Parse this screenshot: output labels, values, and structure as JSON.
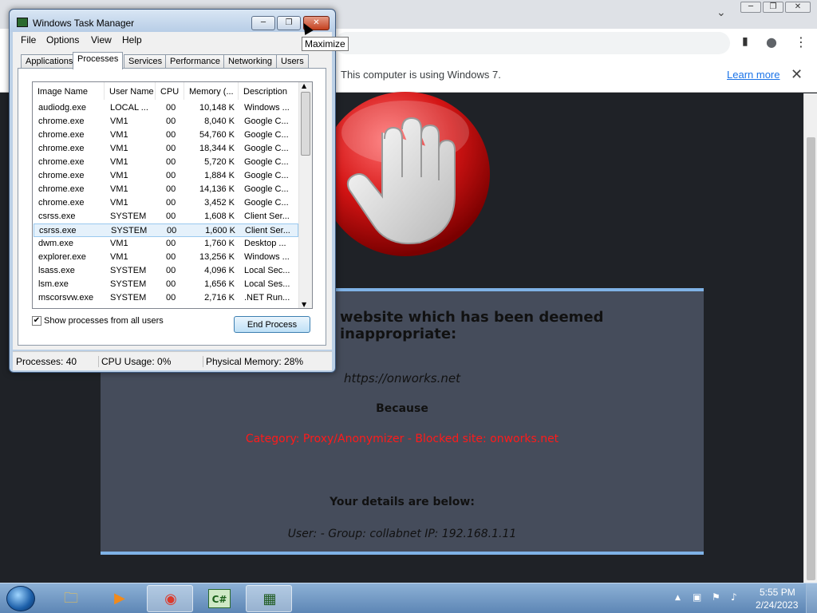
{
  "browser": {
    "window_controls": {
      "minimize": "─",
      "restore": "❐",
      "close": "✕"
    },
    "omnibox_icons": {
      "sidepanel": "▮",
      "profile": "●",
      "menu": "⋮"
    },
    "infobar": {
      "message": "This computer is using Windows 7.",
      "learn_more": "Learn more",
      "close": "✕"
    },
    "page": {
      "headline": "website which has been deemed inappropriate:",
      "blocked_url": "https://onworks.net",
      "because_label": "Because",
      "reason": "Category: Proxy/Anonymizer - Blocked site: onworks.net",
      "details_title": "Your details are below:",
      "details": "User: -    Group: collabnet    IP: 192.168.1.11"
    }
  },
  "task_manager": {
    "title": "Windows Task Manager",
    "buttons": {
      "minimize": "─",
      "maximize": "❐",
      "close": "✕"
    },
    "menu": [
      "File",
      "Options",
      "View",
      "Help"
    ],
    "tabs": [
      "Applications",
      "Processes",
      "Services",
      "Performance",
      "Networking",
      "Users"
    ],
    "active_tab": "Processes",
    "columns": [
      "Image Name",
      "User Name",
      "CPU",
      "Memory (...",
      "Description"
    ],
    "rows": [
      [
        "audiodg.exe",
        "LOCAL ...",
        "00",
        "10,148 K",
        "Windows ..."
      ],
      [
        "chrome.exe",
        "VM1",
        "00",
        "8,040 K",
        "Google C..."
      ],
      [
        "chrome.exe",
        "VM1",
        "00",
        "54,760 K",
        "Google C..."
      ],
      [
        "chrome.exe",
        "VM1",
        "00",
        "18,344 K",
        "Google C..."
      ],
      [
        "chrome.exe",
        "VM1",
        "00",
        "5,720 K",
        "Google C..."
      ],
      [
        "chrome.exe",
        "VM1",
        "00",
        "1,884 K",
        "Google C..."
      ],
      [
        "chrome.exe",
        "VM1",
        "00",
        "14,136 K",
        "Google C..."
      ],
      [
        "chrome.exe",
        "VM1",
        "00",
        "3,452 K",
        "Google C..."
      ],
      [
        "csrss.exe",
        "SYSTEM",
        "00",
        "1,608 K",
        "Client Ser..."
      ],
      [
        "csrss.exe",
        "SYSTEM",
        "00",
        "1,600 K",
        "Client Ser..."
      ],
      [
        "dwm.exe",
        "VM1",
        "00",
        "1,760 K",
        "Desktop ..."
      ],
      [
        "explorer.exe",
        "VM1",
        "00",
        "13,256 K",
        "Windows ..."
      ],
      [
        "lsass.exe",
        "SYSTEM",
        "00",
        "4,096 K",
        "Local Sec..."
      ],
      [
        "lsm.exe",
        "SYSTEM",
        "00",
        "1,656 K",
        "Local Ses..."
      ],
      [
        "mscorsvw.exe",
        "SYSTEM",
        "00",
        "2,716 K",
        ".NET Run..."
      ]
    ],
    "selected_row": 9,
    "show_all_label": "Show processes from all users",
    "show_all_checked": "✔",
    "end_process": "End Process",
    "status": {
      "processes": "Processes: 40",
      "cpu": "CPU Usage: 0%",
      "memory": "Physical Memory: 28%"
    }
  },
  "tooltip": "Maximize",
  "taskbar": {
    "apps": [
      {
        "name": "explorer",
        "glyph": "🗀"
      },
      {
        "name": "media-player",
        "glyph": "▶"
      },
      {
        "name": "chrome",
        "glyph": "◉"
      },
      {
        "name": "csharp",
        "glyph": "C#"
      },
      {
        "name": "task-manager",
        "glyph": "▦"
      }
    ],
    "tray": {
      "arrow": "▲",
      "network": "▣",
      "flag": "⚑",
      "volume": "♪"
    },
    "time": "5:55 PM",
    "date": "2/24/2023"
  }
}
